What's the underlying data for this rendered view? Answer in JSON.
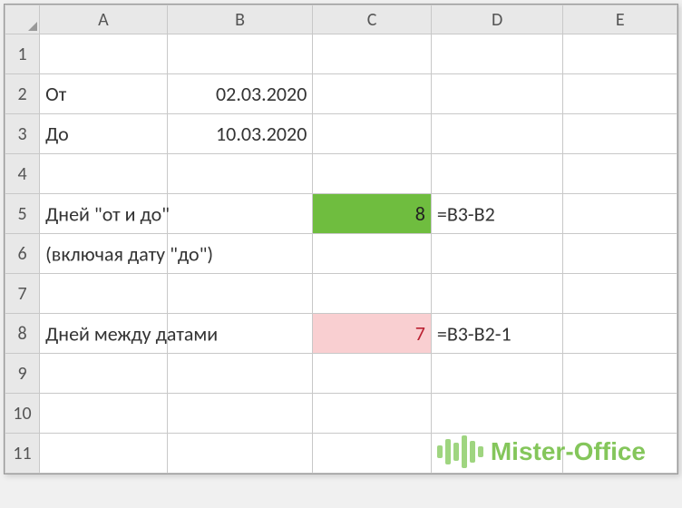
{
  "columns": [
    "A",
    "B",
    "C",
    "D",
    "E"
  ],
  "rows": [
    "1",
    "2",
    "3",
    "4",
    "5",
    "6",
    "7",
    "8",
    "9",
    "10",
    "11"
  ],
  "cells": {
    "A2": "От",
    "B2": "02.03.2020",
    "A3": "До",
    "B3": "10.03.2020",
    "A5": "Дней \"от и до\"",
    "C5": "8",
    "D5": "=B3-B2",
    "A6": "(включая дату \"до\")",
    "A8": "Дней между датами",
    "C8": "7",
    "D8": "=B3-B2-1"
  },
  "watermark": {
    "text": "Mister-Office"
  }
}
